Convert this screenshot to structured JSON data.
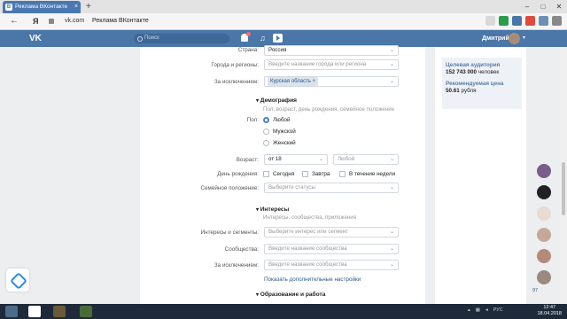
{
  "browser": {
    "tab_title": "Реклама ВКонтакте",
    "tab_close": "×",
    "new_tab": "+",
    "url": "vk.com",
    "page_title": "Реклама ВКонтакте",
    "back": "←",
    "ya": "Я",
    "win_min": "–",
    "win_max": "□",
    "win_close": "✕"
  },
  "vk": {
    "logo": "VK",
    "search_placeholder": "Поиск",
    "music": "♫",
    "user_name": "Дмитрий",
    "user_caret": "▾"
  },
  "form": {
    "country_label": "Страна:",
    "country_value": "Россия",
    "cities_label": "Города и регионы:",
    "cities_placeholder": "Введите название города или региона",
    "except_label": "За исключением:",
    "except_chip": "Курская область ×",
    "demo_title": "Демография",
    "demo_sub": "Пол, возраст, день рождения, семейное положение",
    "sex_label": "Пол:",
    "sex_any": "Любой",
    "sex_male": "Мужской",
    "sex_female": "Женский",
    "age_label": "Возраст:",
    "age_from": "от 18",
    "age_to": "Любой",
    "bday_label": "День рождения:",
    "bday_today": "Сегодня",
    "bday_tomorrow": "Завтра",
    "bday_week": "В течение недели",
    "family_label": "Семейное положение:",
    "family_placeholder": "Выберите статусы",
    "int_title": "Интересы",
    "int_sub": "Интересы, сообщества, приложения",
    "segments_label": "Интересы и сегменты:",
    "segments_placeholder": "Выберите интерес или сегмент",
    "comm_label": "Сообщества:",
    "comm_placeholder": "Введите название сообщества",
    "comm_except_label": "За исключением:",
    "comm_except_placeholder": "Введите название сообщества",
    "more_link": "Показать дополнительные настройки",
    "edu_title": "Образование и работа"
  },
  "sidebar": {
    "audience_label": "Целевая аудитория",
    "audience_value": "152 743 000",
    "audience_unit": "человек",
    "price_label": "Рекомендуемая цена",
    "price_value": "50.61",
    "price_unit": "рубля"
  },
  "right_badge": "97",
  "clock": {
    "time": "12:47",
    "date": "18.04.2018"
  },
  "tray_lang": "РУС",
  "colors": {
    "vk_blue": "#4a76a8",
    "accent": "#5181b8"
  }
}
